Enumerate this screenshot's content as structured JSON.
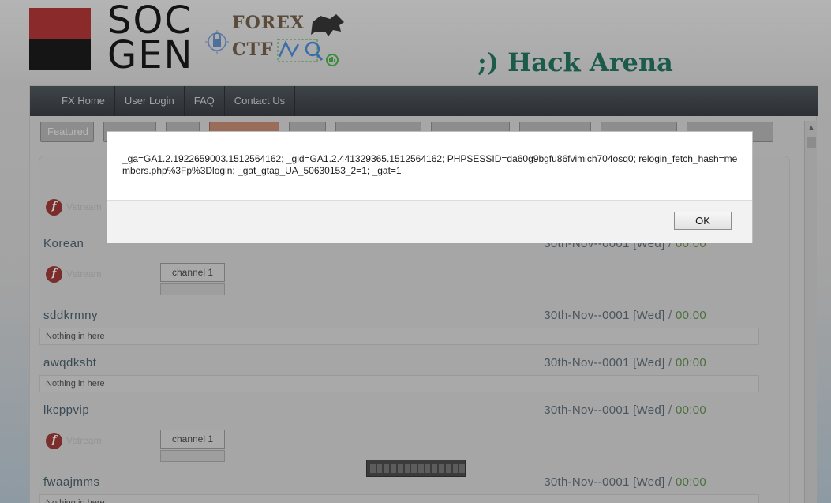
{
  "header": {
    "soc_gen_logo": "SOC GEN",
    "soc_line1": "SOC",
    "soc_line2": "GEN",
    "forex_line1": "FOREX",
    "forex_line2": "CTF",
    "hack_arena": ";) Hack Arena"
  },
  "nav": {
    "items": [
      "FX Home",
      "User Login",
      "FAQ",
      "Contact Us"
    ]
  },
  "tabs": {
    "featured": "Featured"
  },
  "channels": [
    {
      "name": "Korean",
      "date": "30th-Nov--0001 [Wed]",
      "sep": "/",
      "time": "00:00"
    },
    {
      "name": "sddkrmny",
      "date": "30th-Nov--0001 [Wed]",
      "sep": "/",
      "time": "00:00",
      "empty_text": "Nothing in here"
    },
    {
      "name": "awqdksbt",
      "date": "30th-Nov--0001 [Wed]",
      "sep": "/",
      "time": "00:00",
      "empty_text": "Nothing in here"
    },
    {
      "name": "lkcppvip",
      "date": "30th-Nov--0001 [Wed]",
      "sep": "/",
      "time": "00:00"
    },
    {
      "name": "fwaajmms",
      "date": "30th-Nov--0001 [Wed]",
      "sep": "/",
      "time": "00:00",
      "empty_text": "Nothing in here"
    }
  ],
  "stream": {
    "vstream_label": "Vstream",
    "channel_button": "channel 1"
  },
  "dialog": {
    "message": "_ga=GA1.2.1922659003.1512564162; _gid=GA1.2.441329365.1512564162; PHPSESSID=da60g9bgfu86fvimich704osq0; relogin_fetch_hash=members.php%3Fp%3Dlogin; _gat_gtag_UA_50630153_2=1; _gat=1",
    "ok_label": "OK"
  },
  "colors": {
    "nav_bg": "#2c3034",
    "hack_arena": "#1c5a4a",
    "time_green": "#4c6f3e",
    "logo_red": "#8a2a2a"
  }
}
